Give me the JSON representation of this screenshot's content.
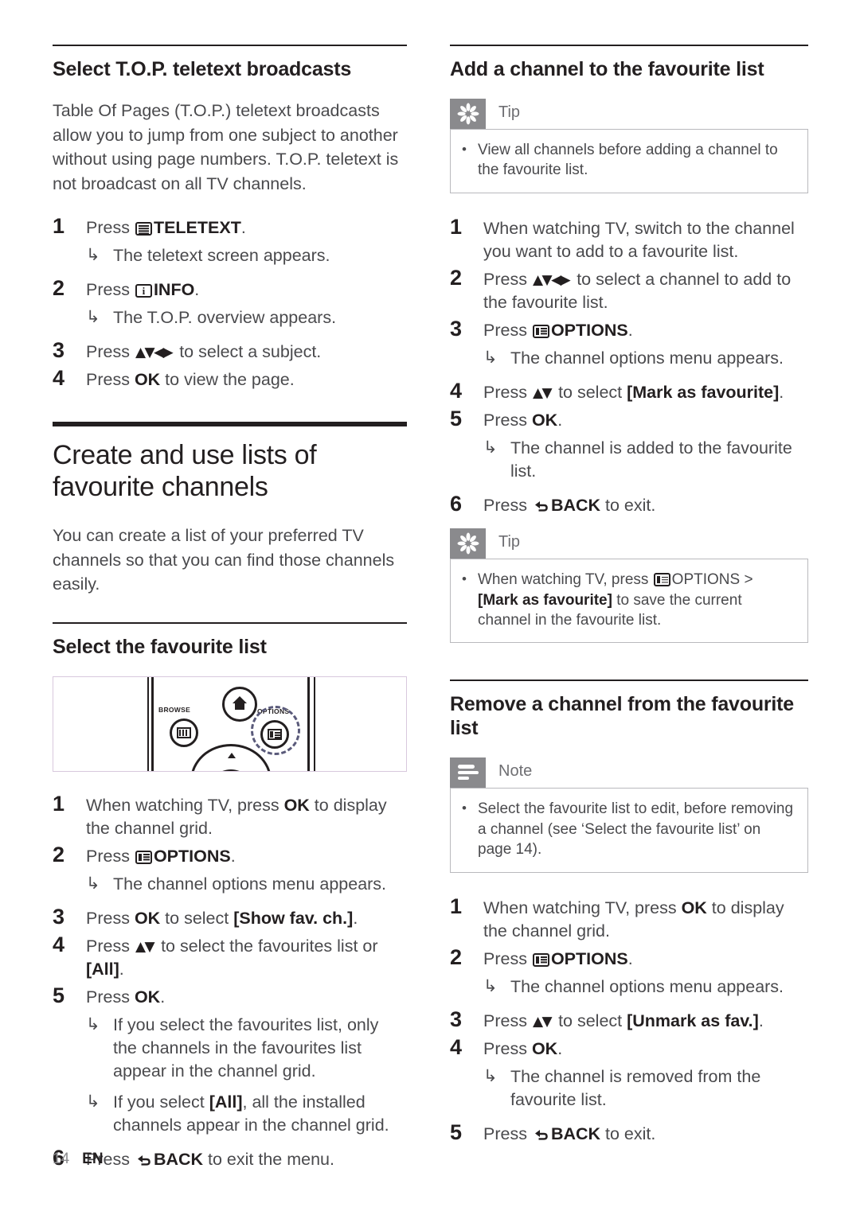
{
  "footer": {
    "page_number": "14",
    "language": "EN"
  },
  "left_column": {
    "section1": {
      "heading": "Select T.O.P. teletext broadcasts",
      "intro": "Table Of Pages (T.O.P.) teletext broadcasts allow you to jump from one subject to another without using page numbers. T.O.P. teletext is not broadcast on all TV channels.",
      "steps": [
        {
          "num": "1",
          "pre": "Press ",
          "icon": "teletext-icon",
          "bold": "TELETEXT",
          "post": "."
        },
        {
          "num": "2",
          "pre": "Press ",
          "icon": "info-icon",
          "bold": "INFO",
          "post": "."
        },
        {
          "num": "3",
          "pre": "Press ",
          "icon": "arrows-updownleftright",
          "post": " to select a subject."
        },
        {
          "num": "4",
          "pre": "Press ",
          "bold": "OK",
          "post": " to view the page."
        }
      ],
      "results": [
        "The teletext screen appears.",
        "The T.O.P. overview appears."
      ]
    },
    "section2": {
      "heading": "Create and use lists of favourite channels",
      "intro": "You can create a list of your preferred TV channels so that you can find those channels easily."
    },
    "section3": {
      "heading": "Select the favourite list",
      "figure": {
        "name": "tv-remote-control-illustration",
        "labels": {
          "browse": "BROWSE",
          "options": "OPTIONS"
        },
        "buttons": [
          "home-button",
          "browse-button",
          "options-button",
          "navigation-dial",
          "ok-button",
          "up-arrow"
        ]
      },
      "steps": [
        {
          "num": "1",
          "text_1": "When watching TV, press ",
          "bold_1": "OK",
          "text_2": " to display the channel grid."
        },
        {
          "num": "2",
          "text_1": "Press ",
          "icon": "options-icon",
          "bold_1": "OPTIONS",
          "text_2": "."
        },
        {
          "num": "3",
          "text_1": "Press ",
          "bold_1": "OK",
          "text_2": " to select ",
          "bold_2": "[Show fav. ch.]",
          "text_3": "."
        },
        {
          "num": "4",
          "text_1": "Press ",
          "icon": "arrows-updown",
          "text_2": " to select the favourites list or ",
          "bold_2": "[All]",
          "text_3": "."
        },
        {
          "num": "5",
          "text_1": "Press ",
          "bold_1": "OK",
          "text_2": "."
        },
        {
          "num": "6",
          "text_1": "Press ",
          "icon": "back-icon",
          "bold_1": "BACK",
          "text_2": " to exit the menu."
        }
      ],
      "results": {
        "step2": "The channel options menu appears.",
        "step5a_pre": "If you select the favourites list, only the channels in the favourites list appear in the channel grid.",
        "step5b_pre": "If you select ",
        "step5b_bold": "[All]",
        "step5b_post": ", all the installed channels appear in the channel grid."
      }
    }
  },
  "right_column": {
    "section1": {
      "heading": "Add a channel to the favourite list",
      "tip": {
        "label": "Tip",
        "icon": "tip-asterisk-icon",
        "bullet": "•",
        "text": "View all channels before adding a channel to the favourite list."
      },
      "steps": [
        {
          "num": "1",
          "text_1": "When watching TV, switch to the channel you want to add to a favourite list."
        },
        {
          "num": "2",
          "text_1": "Press ",
          "icon": "arrows-updownleftright",
          "text_2": " to select a channel to add to the favourite list."
        },
        {
          "num": "3",
          "text_1": "Press ",
          "icon": "options-icon",
          "bold_1": "OPTIONS",
          "text_2": "."
        },
        {
          "num": "4",
          "text_1": "Press ",
          "icon": "arrows-updown",
          "text_2": " to select ",
          "bold_2": "[Mark as favourite]",
          "text_3": "."
        },
        {
          "num": "5",
          "text_1": "Press ",
          "bold_1": "OK",
          "text_2": "."
        },
        {
          "num": "6",
          "text_1": "Press ",
          "icon": "back-icon",
          "bold_1": "BACK",
          "text_2": " to exit."
        }
      ],
      "results": {
        "step3": "The channel options menu appears.",
        "step5": "The channel is added to the favourite list."
      },
      "tip2": {
        "label": "Tip",
        "icon": "tip-asterisk-icon",
        "bullet": "•",
        "text_1": "When watching TV, press ",
        "icon_inline": "options-icon",
        "text_2": "OPTIONS > ",
        "bold_1": "[Mark as favourite]",
        "text_3": " to save the current channel in the favourite list."
      }
    },
    "section2": {
      "heading": "Remove a channel from the favourite list",
      "note": {
        "label": "Note",
        "icon": "note-lines-icon",
        "bullet": "•",
        "text": "Select the favourite list to edit, before removing a channel (see ‘Select the favourite list’ on page 14)."
      },
      "steps": [
        {
          "num": "1",
          "text_1": "When watching TV, press ",
          "bold_1": "OK",
          "text_2": " to display the channel grid."
        },
        {
          "num": "2",
          "text_1": "Press ",
          "icon": "options-icon",
          "bold_1": "OPTIONS",
          "text_2": "."
        },
        {
          "num": "3",
          "text_1": "Press ",
          "icon": "arrows-updown",
          "text_2": " to select ",
          "bold_2": "[Unmark as fav.]",
          "text_3": "."
        },
        {
          "num": "4",
          "text_1": "Press ",
          "bold_1": "OK",
          "text_2": "."
        },
        {
          "num": "5",
          "text_1": "Press ",
          "icon": "back-icon",
          "bold_1": "BACK",
          "text_2": " to exit."
        }
      ],
      "results": {
        "step2": "The channel options menu appears.",
        "step4": "The channel is removed from the favourite list."
      }
    }
  },
  "glyphs": {
    "result_hook": "↳",
    "arrows_updownleftright": "▲▼◀▶",
    "arrows_updown": "▲▼"
  }
}
